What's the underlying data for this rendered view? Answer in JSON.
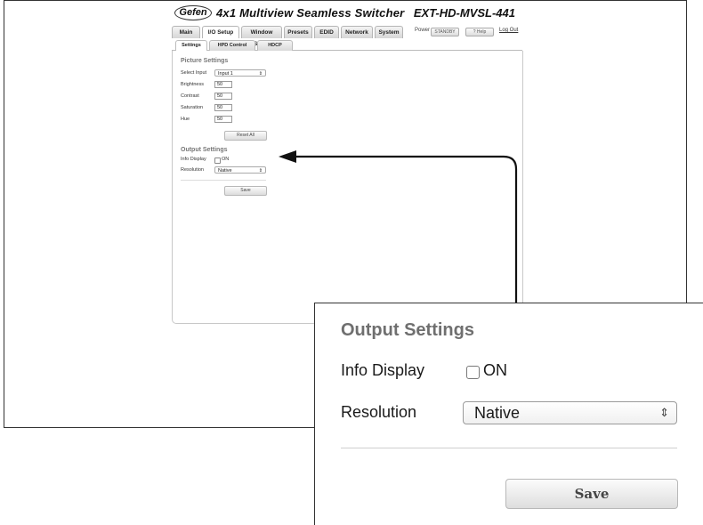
{
  "app": {
    "logo": "Gefen",
    "title": "4x1 Multiview Seamless Switcher",
    "model": "EXT-HD-MVSL-441"
  },
  "nav": {
    "tabs": [
      "Main",
      "I/O Setup",
      "Window Setup",
      "Presets",
      "EDID",
      "Network",
      "System"
    ],
    "active": "I/O Setup",
    "power_label": "Power",
    "standby_label": "STANDBY",
    "help_label": "? Help",
    "logout_label": "Log Out"
  },
  "subnav": {
    "tabs": [
      "Settings",
      "HPD Control",
      "HDCP"
    ],
    "active": "Settings"
  },
  "picture_settings": {
    "title": "Picture Settings",
    "select_input_label": "Select Input",
    "select_input_value": "Input 1",
    "brightness_label": "Brightness",
    "brightness_value": "50",
    "contrast_label": "Contrast",
    "contrast_value": "50",
    "saturation_label": "Saturation",
    "saturation_value": "50",
    "hue_label": "Hue",
    "hue_value": "50",
    "reset_label": "Reset All"
  },
  "output_settings": {
    "title": "Output Settings",
    "info_display_label": "Info Display",
    "info_display_option": "ON",
    "info_display_checked": false,
    "resolution_label": "Resolution",
    "resolution_value": "Native",
    "save_label": "Save"
  },
  "colors": {
    "section_title": "#777777",
    "border": "#333333"
  }
}
